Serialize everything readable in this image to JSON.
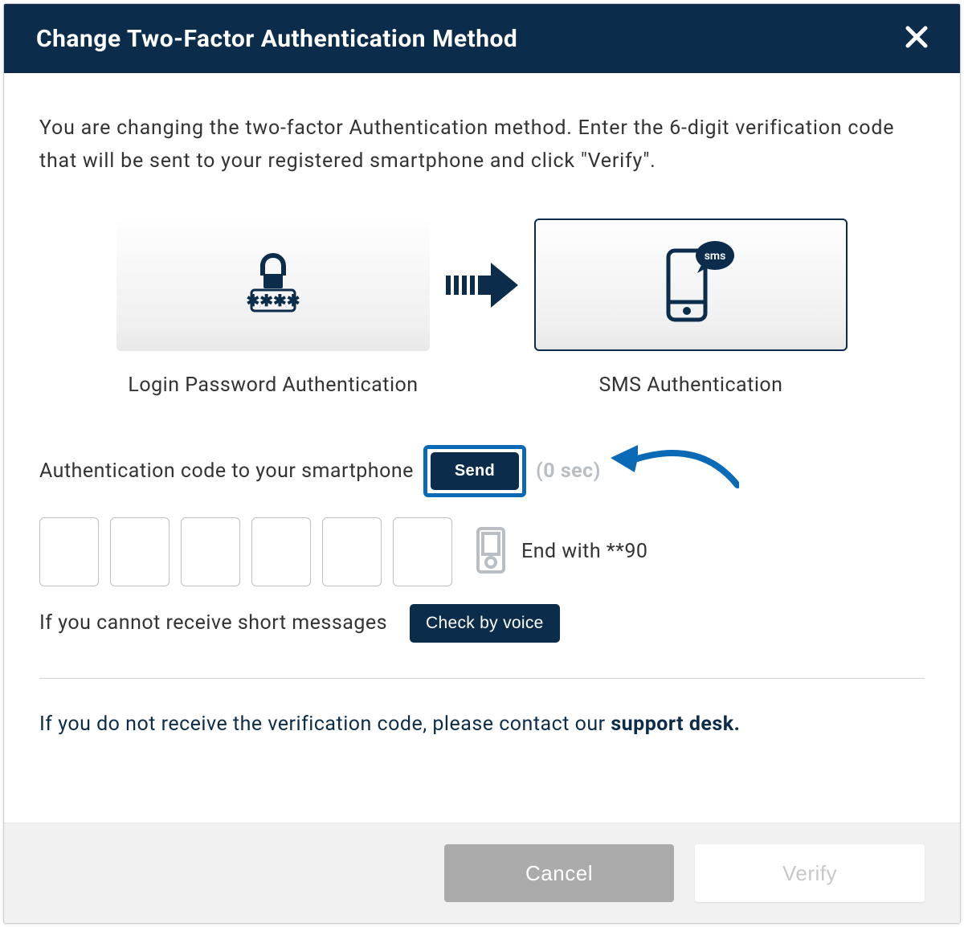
{
  "header": {
    "title": "Change Two-Factor Authentication Method"
  },
  "intro": "You are changing the two-factor Authentication method. Enter the 6-digit verification code that will be sent to your registered smartphone and click \"Verify\".",
  "methods": {
    "from_label": "Login Password Authentication",
    "to_label": "SMS Authentication",
    "sms_bubble": "sms"
  },
  "send": {
    "label": "Authentication code to your smartphone",
    "button": "Send",
    "timer": "(0 sec)"
  },
  "device": {
    "end_with": "End with **90"
  },
  "voice": {
    "label": "If you cannot receive short messages",
    "button": "Check by voice"
  },
  "support": {
    "prefix": "If you do not receive the verification code, please contact our ",
    "link": "support desk."
  },
  "footer": {
    "cancel": "Cancel",
    "verify": "Verify"
  }
}
